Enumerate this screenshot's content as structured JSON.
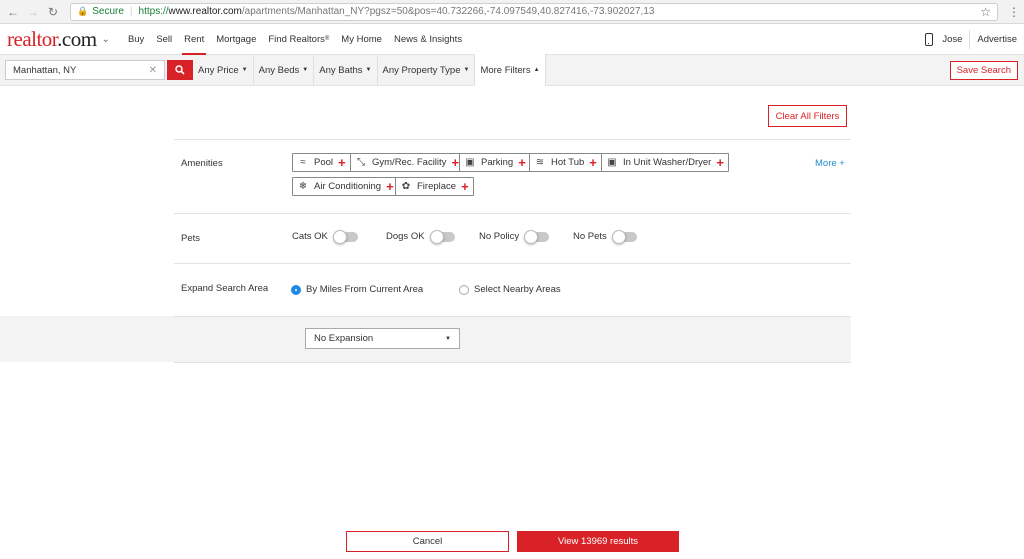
{
  "browser": {
    "secure_label": "Secure",
    "url_proto": "https://",
    "url_host": "www.realtor.com",
    "url_path": "/apartments/Manhattan_NY?pgsz=50&pos=40.732266,-74.097549,40.827416,-73.902027,13"
  },
  "header": {
    "logo_brand": "realtor",
    "logo_rest": ".com",
    "nav": [
      "Buy",
      "Sell",
      "Rent",
      "Mortgage",
      "Find Realtors",
      "My Home",
      "News & Insights"
    ],
    "nav_sup": "®",
    "active_nav": "Rent",
    "user": "Jose",
    "advertise": "Advertise"
  },
  "filter_bar": {
    "search_value": "Manhattan, NY",
    "price": "Any Price",
    "beds": "Any Beds",
    "baths": "Any Baths",
    "property_type": "Any Property Type",
    "more_filters": "More Filters",
    "save_search": "Save Search"
  },
  "panel": {
    "clear_all": "Clear All Filters",
    "amenities_label": "Amenities",
    "amenities": [
      "Pool",
      "Gym/Rec. Facility",
      "Parking",
      "Hot Tub",
      "In Unit Washer/Dryer",
      "Air Conditioning",
      "Fireplace"
    ],
    "more": "More +",
    "pets_label": "Pets",
    "pets": [
      "Cats OK",
      "Dogs OK",
      "No Policy",
      "No Pets"
    ],
    "expand_label": "Expand Search Area",
    "expand_options": [
      "By Miles From Current Area",
      "Select Nearby Areas"
    ],
    "expand_selected": "By Miles From Current Area",
    "expansion_select": "No Expansion"
  },
  "footer": {
    "cancel": "Cancel",
    "view_results": "View 13969 results"
  },
  "colors": {
    "brand_red": "#d92228",
    "link_blue": "#1f8fcf",
    "radio_blue": "#1e88e5"
  }
}
